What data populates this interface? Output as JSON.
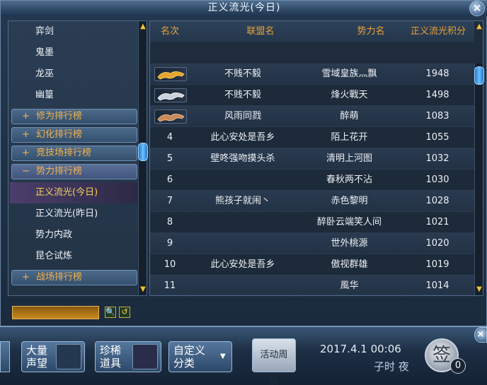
{
  "window": {
    "title": "正义流光(今日)",
    "close_icon": "×"
  },
  "sidebar": {
    "items": [
      {
        "label": "弈剑",
        "type": "item"
      },
      {
        "label": "鬼墨",
        "type": "item"
      },
      {
        "label": "龙巫",
        "type": "item"
      },
      {
        "label": "幽篁",
        "type": "item"
      },
      {
        "label": "修为排行榜",
        "type": "category",
        "sign": "+"
      },
      {
        "label": "幻化排行榜",
        "type": "category",
        "sign": "+"
      },
      {
        "label": "竞技场排行榜",
        "type": "category",
        "sign": "+"
      },
      {
        "label": "势力排行榜",
        "type": "category-open",
        "sign": "−"
      },
      {
        "label": "正义流光(今日)",
        "type": "selected"
      },
      {
        "label": "正义流光(昨日)",
        "type": "item"
      },
      {
        "label": "势力内政",
        "type": "item"
      },
      {
        "label": "昆仑试炼",
        "type": "item"
      },
      {
        "label": "战场排行榜",
        "type": "category",
        "sign": "+"
      }
    ],
    "scroll_up": "▲",
    "scroll_down": "▼"
  },
  "table": {
    "headers": {
      "rank": "名次",
      "alliance": "联盟名",
      "force": "势力名",
      "points": "正义流光积分"
    },
    "rows": [
      {
        "rank": "",
        "icon": "gold-tiger-icon",
        "alliance": "不贱不毅",
        "force": "雪域皇族灬飘",
        "points": "1948"
      },
      {
        "rank": "",
        "icon": "silver-tiger-icon",
        "alliance": "不贱不毅",
        "force": "烽火戰天",
        "points": "1498"
      },
      {
        "rank": "",
        "icon": "bronze-tiger-icon",
        "alliance": "风雨同戮",
        "force": "醉萌",
        "points": "1083"
      },
      {
        "rank": "4",
        "alliance": "此心安处是吾乡",
        "force": "陌上花开",
        "points": "1055"
      },
      {
        "rank": "5",
        "alliance": "壁咚强吻摸头杀",
        "force": "清明上河图",
        "points": "1032"
      },
      {
        "rank": "6",
        "alliance": "",
        "force": "春秋两不沾",
        "points": "1030"
      },
      {
        "rank": "7",
        "alliance": "熊孩子就闹丶",
        "force": "赤色黎明",
        "points": "1028"
      },
      {
        "rank": "8",
        "alliance": "",
        "force": "醉卧云端笑人间",
        "points": "1021"
      },
      {
        "rank": "9",
        "alliance": "",
        "force": "世外桃源",
        "points": "1020"
      },
      {
        "rank": "10",
        "alliance": "此心安处是吾乡",
        "force": "傲视群雄",
        "points": "1019"
      },
      {
        "rank": "11",
        "alliance": "",
        "force": "風华",
        "points": "1014"
      }
    ],
    "scroll_up": "▲",
    "scroll_down": "▼"
  },
  "search": {
    "value": "",
    "search_icon": "🔍",
    "reset_icon": "↺"
  },
  "taskbar": {
    "btn1": {
      "line1": "大量",
      "line2": "声望"
    },
    "btn2": {
      "line1": "珍稀",
      "line2": "道具"
    },
    "btn3": {
      "line1": "自定义",
      "line2": "分类",
      "arrow": "▼"
    },
    "btn4": {
      "label": "活动周历"
    },
    "date": "2017.4.1",
    "time": "00:06",
    "shichen": "子时 夜",
    "sign_label": "签",
    "sign_count": "0",
    "close_icon": "×"
  },
  "colors": {
    "header_gold": "#e8a23a",
    "category_orange": "#f5b24a",
    "selected_yellow": "#f5d056"
  }
}
